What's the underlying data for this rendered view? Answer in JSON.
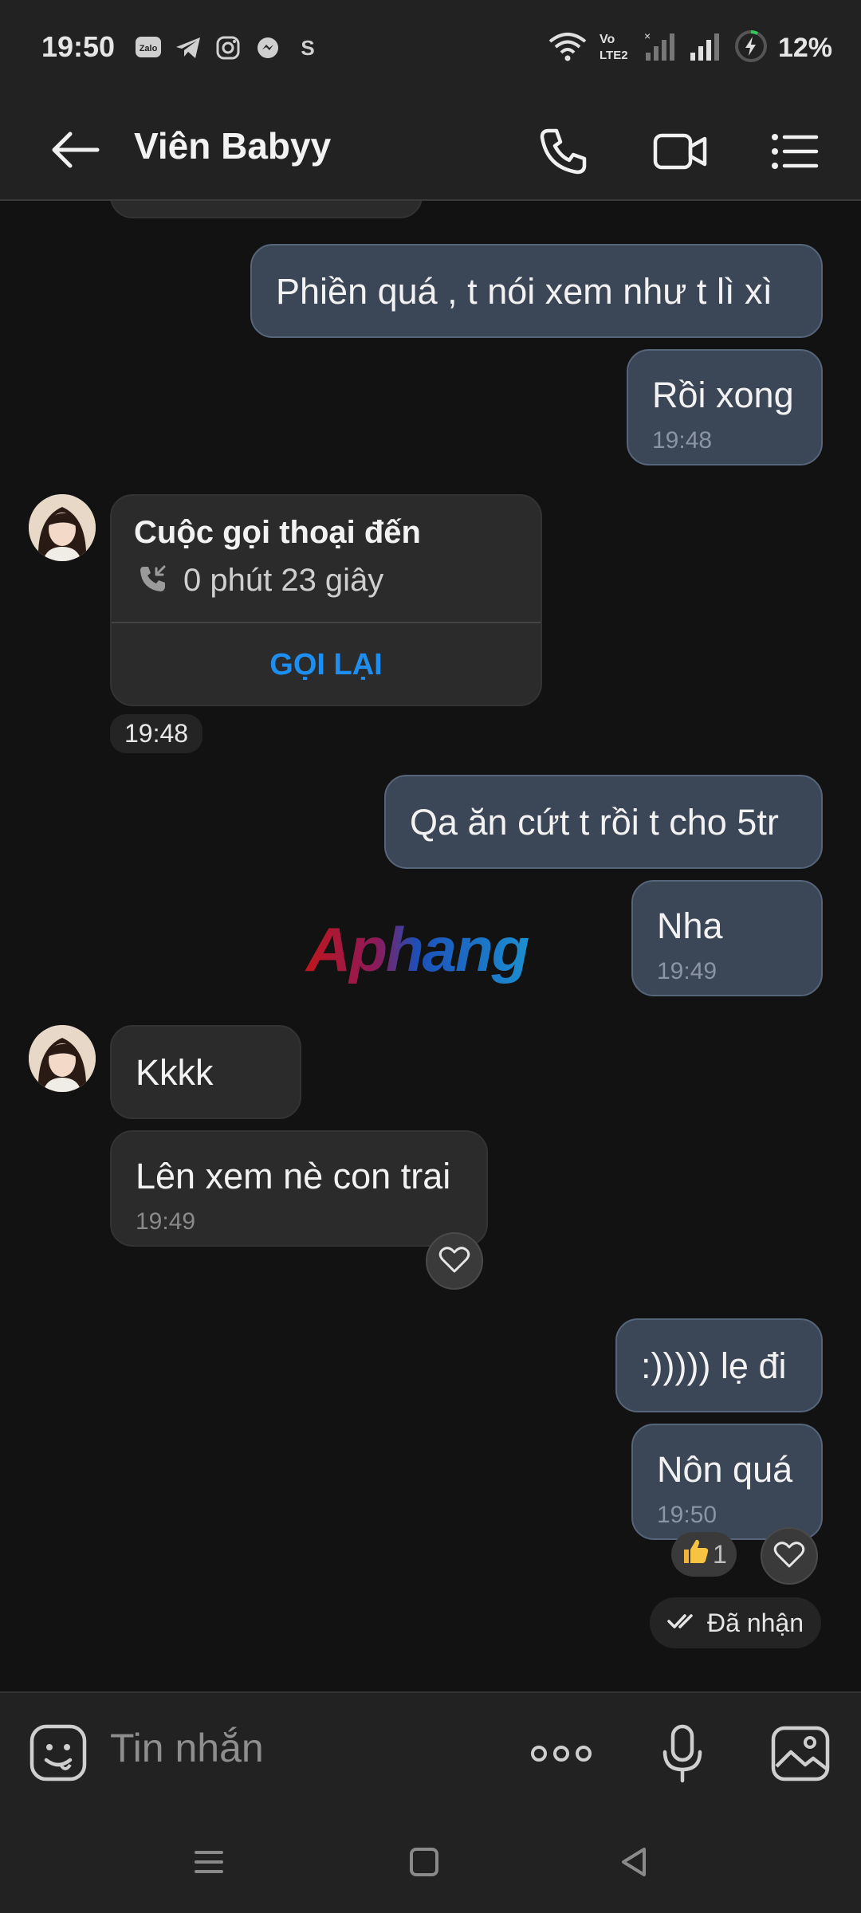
{
  "status_bar": {
    "time": "19:50",
    "network": "Vo LTE2",
    "battery": "12%",
    "app_icons": [
      "zalo-icon",
      "telegram-icon",
      "instagram-icon",
      "messenger-icon",
      "s-icon"
    ]
  },
  "header": {
    "title": "Viên Babyy",
    "icons": [
      "back-arrow-icon",
      "phone-icon",
      "video-icon",
      "menu-list-icon"
    ]
  },
  "messages": [
    {
      "side": "out",
      "text": "Phiền quá , t nói xem như t lì xì",
      "time": ""
    },
    {
      "side": "out",
      "text": "Rồi xong",
      "time": "19:48"
    },
    {
      "side": "in",
      "type": "call",
      "title": "Cuộc gọi thoại đến",
      "duration": "0 phút 23 giây",
      "action": "GỌI LẠI"
    },
    {
      "side": "in",
      "type": "stamp",
      "time": "19:48"
    },
    {
      "side": "out",
      "text": "Qa ăn cứt t rồi t cho 5tr",
      "time": ""
    },
    {
      "side": "out",
      "text": "Nha",
      "time": "19:49"
    },
    {
      "side": "in",
      "text": "Kkkk",
      "time": ""
    },
    {
      "side": "in",
      "text": "Lên xem nè con trai",
      "time": "19:49"
    },
    {
      "side": "out",
      "text": ":))))) lẹ đi",
      "time": ""
    },
    {
      "side": "out",
      "text": "Nôn quá",
      "time": "19:50"
    }
  ],
  "reactions": {
    "like_count": "1"
  },
  "delivery_status": "Đã nhận",
  "watermark": "Aphang",
  "input": {
    "placeholder": "Tin nhắn"
  },
  "colors": {
    "background": "#121212",
    "bar": "#222222",
    "outgoing_bubble": "#3b4656",
    "incoming_bubble": "#2b2b2b",
    "link_blue": "#1f8ef1",
    "watermark_red": "#c0161d",
    "watermark_blue": "#1d6fb8"
  }
}
